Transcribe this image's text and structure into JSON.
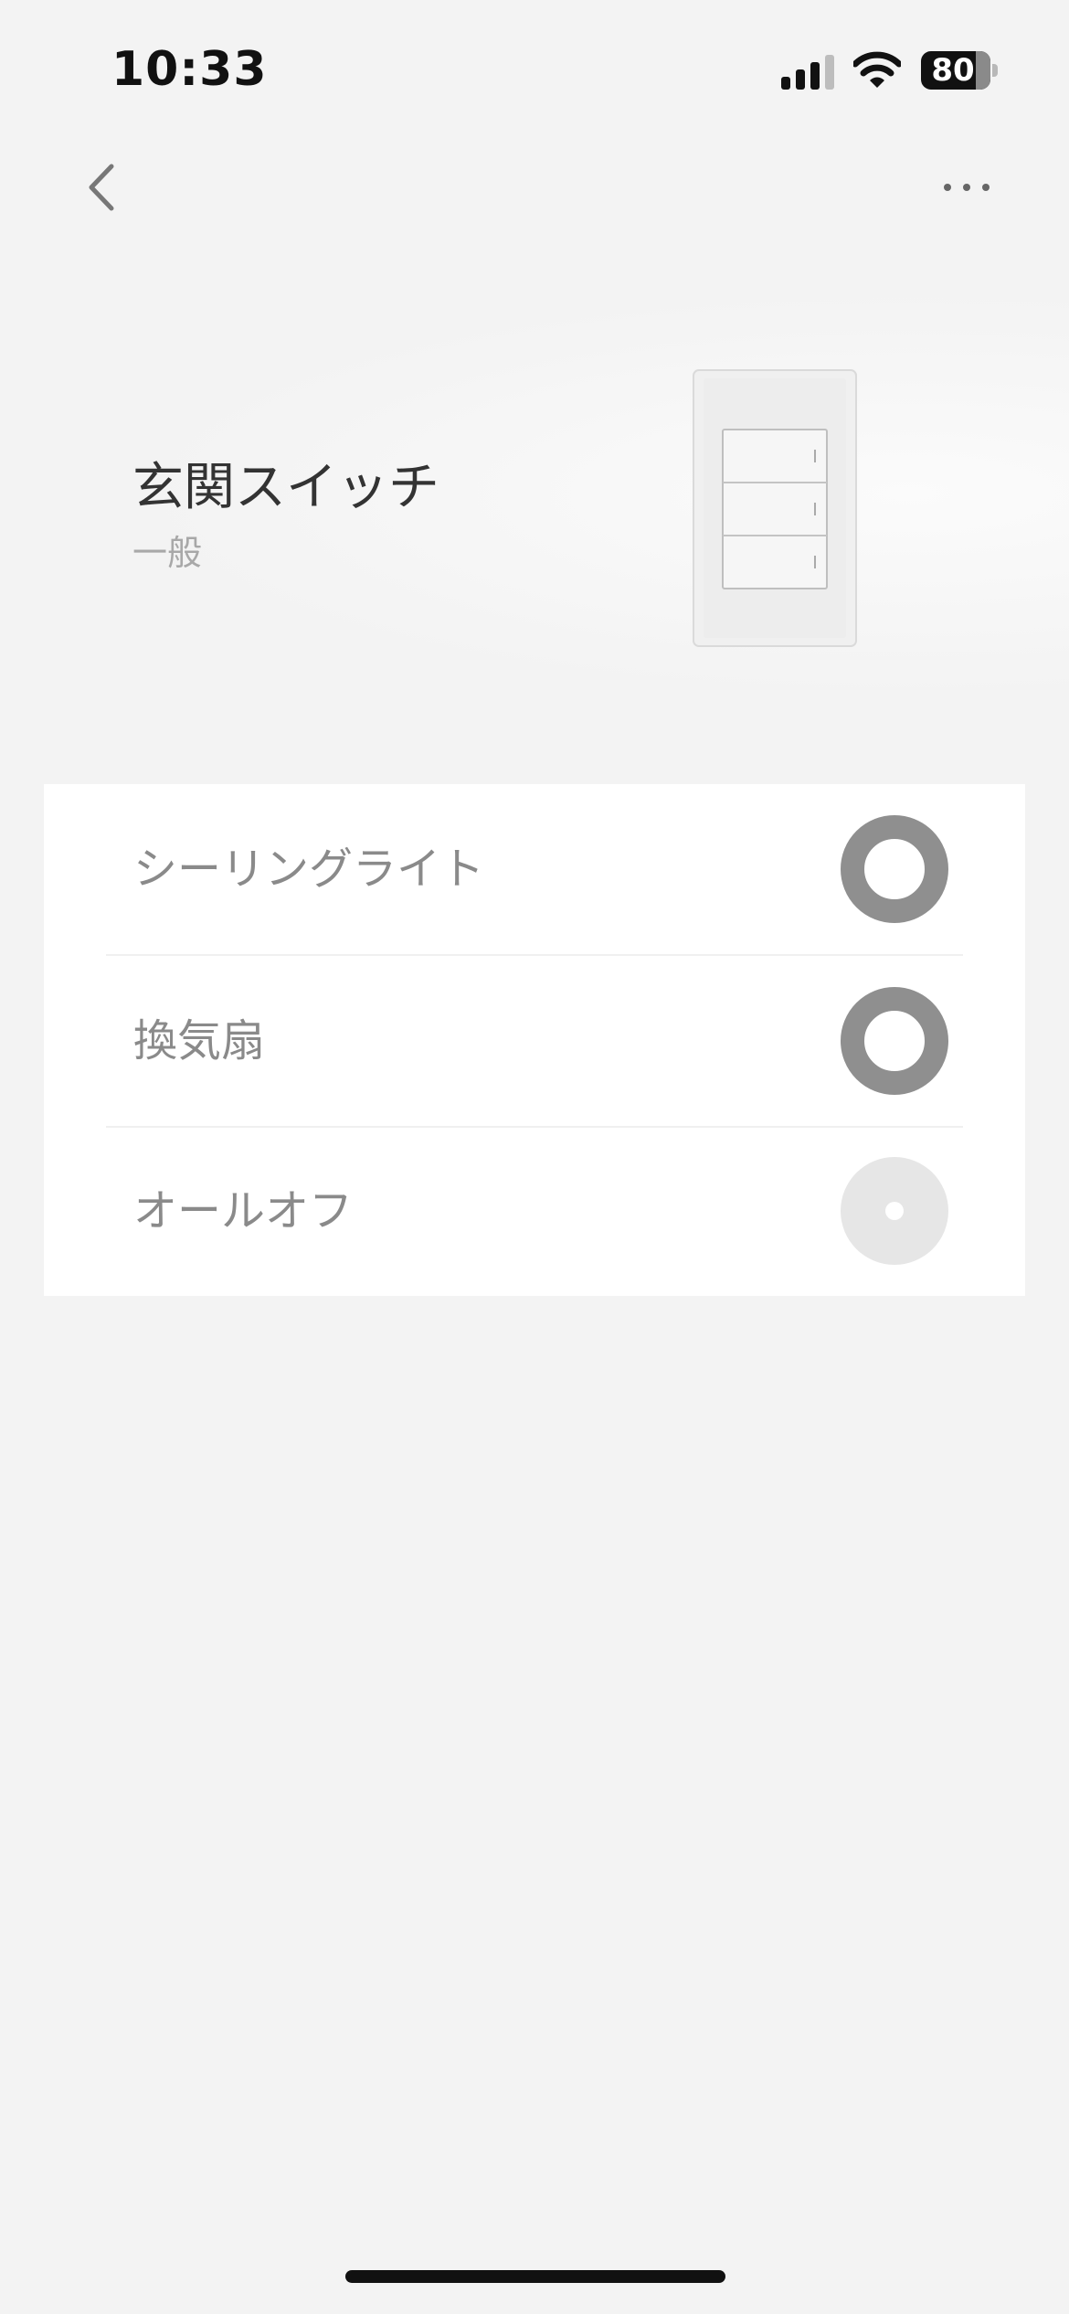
{
  "status_bar": {
    "time": "10:33",
    "battery_level": "80",
    "icons": [
      "cellular-signal-icon",
      "wifi-icon",
      "battery-icon"
    ]
  },
  "nav": {
    "back_icon": "chevron-left-icon",
    "more_icon": "ellipsis-icon"
  },
  "device": {
    "name": "玄関スイッチ",
    "category": "一般",
    "image": "wall-switch-3-gang"
  },
  "switches": [
    {
      "label": "シーリングライト",
      "state": "on"
    },
    {
      "label": "換気扇",
      "state": "on"
    },
    {
      "label": "オールオフ",
      "state": "off"
    }
  ],
  "colors": {
    "background": "#f3f3f3",
    "card": "#ffffff",
    "toggle_on": "#8f8f8f",
    "toggle_off": "#e6e6e6",
    "label": "#8a8a8a"
  }
}
